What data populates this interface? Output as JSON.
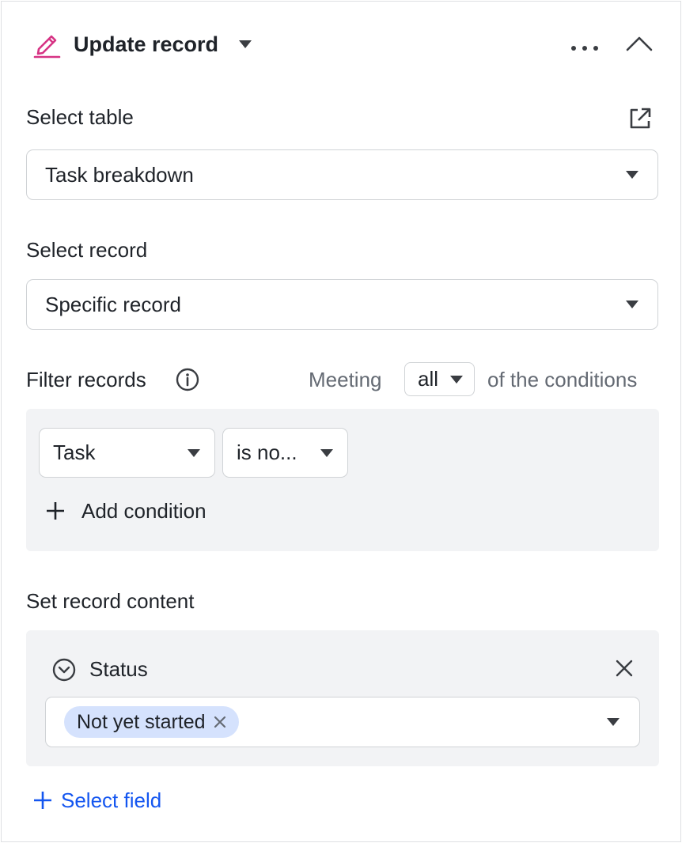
{
  "header": {
    "title": "Update record"
  },
  "select_table": {
    "label": "Select table",
    "value": "Task breakdown"
  },
  "select_record": {
    "label": "Select record",
    "value": "Specific record"
  },
  "filter": {
    "label": "Filter records",
    "meeting_prefix": "Meeting",
    "meeting_value": "all",
    "meeting_suffix": "of the conditions",
    "condition_field": "Task",
    "condition_operator": "is no...",
    "add_condition": "Add condition"
  },
  "content": {
    "label": "Set record content",
    "field_name": "Status",
    "tag": "Not yet started",
    "select_field": "Select field"
  },
  "colors": {
    "accent": "#1456f0",
    "pencil_icon": "#d63384",
    "tag_bg": "#d5e2fd",
    "panel_bg": "#f2f3f5"
  }
}
